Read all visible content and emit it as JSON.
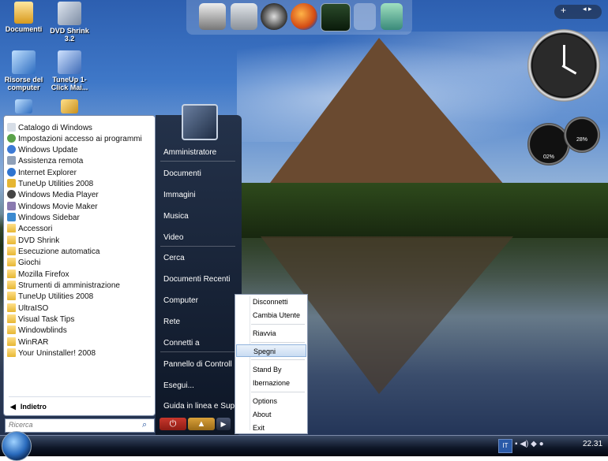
{
  "desktop_icons": [
    {
      "label": "Documenti"
    },
    {
      "label": "DVD Shrink 3.2"
    },
    {
      "label": "Risorse del computer"
    },
    {
      "label": "TuneUp 1-Click Mai..."
    }
  ],
  "start_menu": {
    "programs": [
      {
        "label": "Catalogo di Windows",
        "icon": "catalog-icon"
      },
      {
        "label": "Impostazioni accesso ai programmi",
        "icon": "program-access-icon"
      },
      {
        "label": "Windows Update",
        "icon": "windows-update-icon"
      },
      {
        "label": "Assistenza remota",
        "icon": "remote-assistance-icon"
      },
      {
        "label": "Internet Explorer",
        "icon": "internet-explorer-icon"
      },
      {
        "label": "TuneUp Utilities 2008",
        "icon": "tuneup-icon"
      },
      {
        "label": "Windows Media Player",
        "icon": "media-player-icon"
      },
      {
        "label": "Windows Movie Maker",
        "icon": "movie-maker-icon"
      },
      {
        "label": "Windows Sidebar",
        "icon": "sidebar-icon"
      },
      {
        "label": "Accessori",
        "icon": "folder-icon"
      },
      {
        "label": "DVD Shrink",
        "icon": "folder-icon"
      },
      {
        "label": "Esecuzione automatica",
        "icon": "folder-icon"
      },
      {
        "label": "Giochi",
        "icon": "folder-icon"
      },
      {
        "label": "Mozilla Firefox",
        "icon": "folder-icon"
      },
      {
        "label": "Strumenti di amministrazione",
        "icon": "folder-icon"
      },
      {
        "label": "TuneUp Utilities 2008",
        "icon": "folder-icon"
      },
      {
        "label": "UltraISO",
        "icon": "folder-icon"
      },
      {
        "label": "Visual Task Tips",
        "icon": "folder-icon"
      },
      {
        "label": "Windowblinds",
        "icon": "folder-icon"
      },
      {
        "label": "WinRAR",
        "icon": "folder-icon"
      },
      {
        "label": "Your Uninstaller! 2008",
        "icon": "folder-icon"
      }
    ],
    "back_label": "Indietro",
    "search_placeholder": "Ricerca",
    "right_items": [
      {
        "label": "Amministratore"
      },
      {
        "label": "Documenti"
      },
      {
        "label": "Immagini"
      },
      {
        "label": "Musica"
      },
      {
        "label": "Video"
      },
      {
        "label": "Cerca"
      },
      {
        "label": "Documenti Recenti"
      },
      {
        "label": "Computer"
      },
      {
        "label": "Rete"
      },
      {
        "label": "Connetti a"
      },
      {
        "label": "Pannello di Controll"
      },
      {
        "label": "Esegui..."
      },
      {
        "label": "Guida in linea e Sup"
      }
    ]
  },
  "power_menu": {
    "items": [
      {
        "label": "Disconnetti"
      },
      {
        "label": "Cambia Utente"
      },
      {
        "label": "Riavvia"
      },
      {
        "label": "Spegni",
        "highlighted": true
      },
      {
        "label": "Stand By"
      },
      {
        "label": "Ibernazione"
      },
      {
        "label": "Options"
      },
      {
        "label": "About"
      },
      {
        "label": "Exit"
      }
    ]
  },
  "gadgets": {
    "gauge_left": "02%",
    "gauge_right": "28%"
  },
  "taskbar": {
    "lang": "IT",
    "time": "22.31"
  },
  "colors": {
    "start_menu_right": "#1a2438",
    "highlight": "#c9dcf2",
    "taskbar": "#0d1526"
  }
}
